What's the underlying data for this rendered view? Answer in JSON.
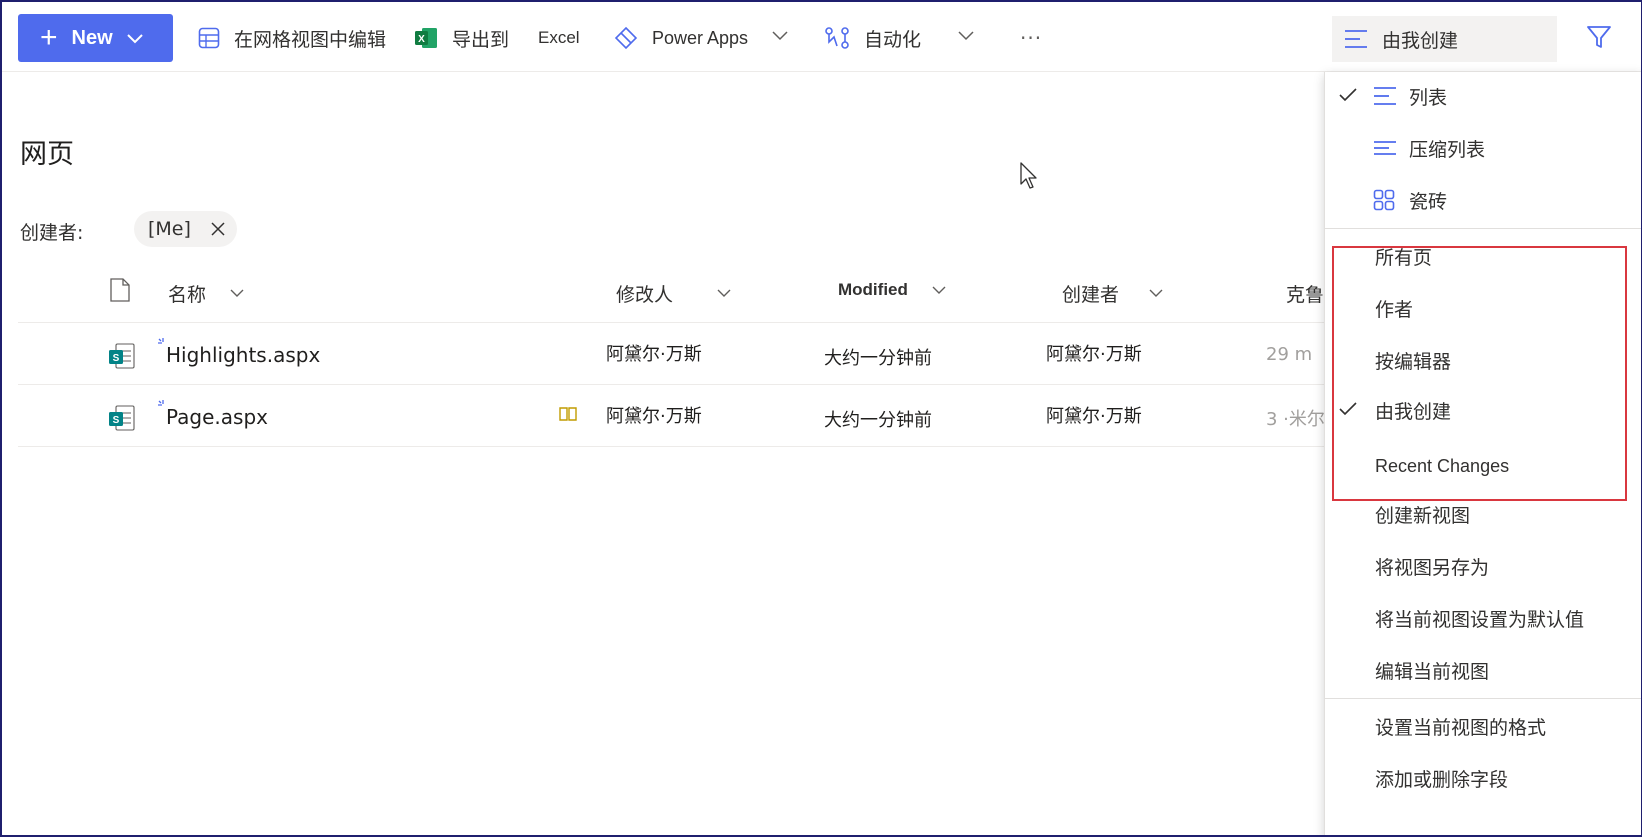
{
  "toolbar": {
    "new_label": "New",
    "edit_grid_label": "在网格视图中编辑",
    "export_label": "导出到",
    "excel_label": "Excel",
    "power_apps_label": "Power Apps",
    "automate_label": "自动化",
    "more_label": "···",
    "current_view_label": "由我创建"
  },
  "page": {
    "title": "网页",
    "filter_label": "创建者:",
    "filter_pill": "[Me]"
  },
  "columns": {
    "name": "名称",
    "modified_by": "修改人",
    "modified": "Modified",
    "created_by": "创建者",
    "partial": "克鲁兹"
  },
  "rows": [
    {
      "name": "Highlights.aspx",
      "modified_by": "阿黛尔·万斯",
      "modified": "大约一分钟前",
      "created_by": "阿黛尔·万斯",
      "extra": "29 m"
    },
    {
      "name": "Page.aspx",
      "modified_by": "阿黛尔·万斯",
      "modified": "大约一分钟前",
      "created_by": "阿黛尔·万斯",
      "extra": "3 ·米尔"
    }
  ],
  "menu": {
    "layout_items": [
      {
        "label": "列表",
        "checked": true,
        "icon": "list-icon"
      },
      {
        "label": "压缩列表",
        "checked": false,
        "icon": "compact-list-icon"
      },
      {
        "label": "瓷砖",
        "checked": false,
        "icon": "tiles-icon"
      }
    ],
    "view_items": [
      {
        "label": "所有页",
        "checked": false
      },
      {
        "label": "作者",
        "checked": false
      },
      {
        "label": "按编辑器",
        "checked": false
      },
      {
        "label": "由我创建",
        "checked": true
      },
      {
        "label": "Recent Changes",
        "checked": false
      }
    ],
    "action_items": [
      {
        "label": "创建新视图"
      },
      {
        "label": "将视图另存为"
      },
      {
        "label": "将当前视图设置为默认值"
      },
      {
        "label": "编辑当前视图"
      }
    ],
    "format_items": [
      {
        "label": "设置当前视图的格式"
      },
      {
        "label": "添加或删除字段"
      }
    ]
  },
  "colors": {
    "accent": "#4f6bed",
    "highlight_border": "#d9373f",
    "sharepoint_green": "#038387"
  }
}
